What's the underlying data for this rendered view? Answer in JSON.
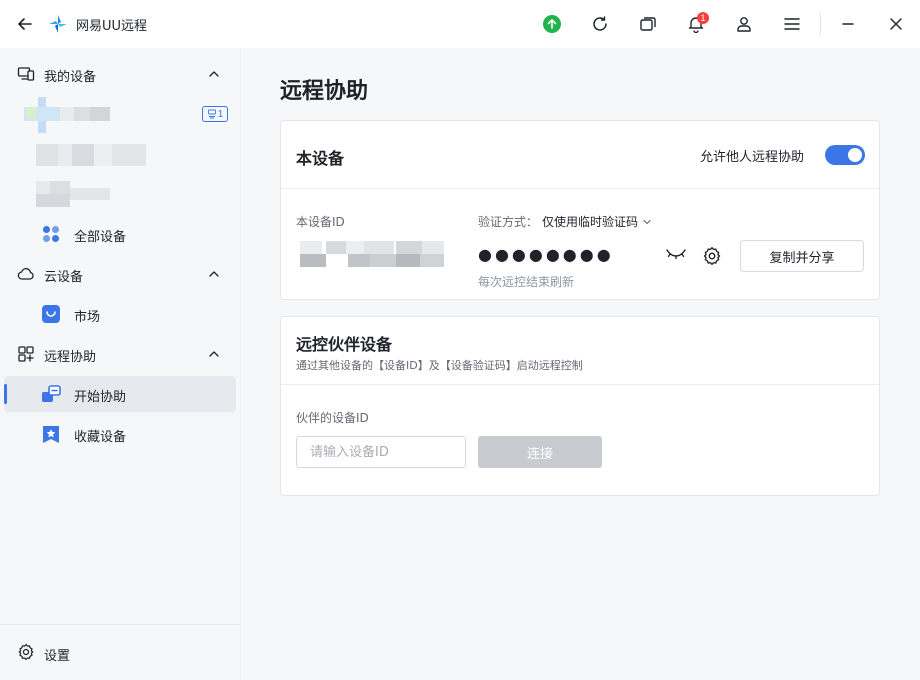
{
  "app": {
    "title": "网易UU远程"
  },
  "titlebar": {
    "notifications_count": "1",
    "icons": [
      "back-arrow-icon",
      "upgrade-icon",
      "refresh-icon",
      "windows-icon",
      "bell-icon",
      "user-icon",
      "menu-icon",
      "minimize-icon",
      "close-icon"
    ],
    "upgrade_color": "#22b34c",
    "badge_color": "#f5413d"
  },
  "sidebar": {
    "my_devices": {
      "label": "我的设备",
      "device_count": "1",
      "all_devices_label": "全部设备"
    },
    "cloud_devices": {
      "label": "云设备",
      "market_label": "市场"
    },
    "remote_assist": {
      "label": "远程协助",
      "start_label": "开始协助",
      "favorites_label": "收藏设备"
    },
    "settings_label": "设置"
  },
  "main": {
    "title": "远程协助",
    "this_device": {
      "title": "本设备",
      "allow_label": "允许他人远程协助",
      "allow_enabled": true,
      "id_label": "本设备ID",
      "verify_label": "验证方式：",
      "verify_value": "仅使用临时验证码",
      "password_masked": "●●●●●●●●",
      "refresh_note": "每次远控结束刷新",
      "share_button": "复制并分享"
    },
    "partner": {
      "title": "远控伙伴设备",
      "subtitle": "通过其他设备的【设备ID】及【设备验证码】启动远程控制",
      "id_label": "伙伴的设备ID",
      "input_placeholder": "请输入设备ID",
      "connect_button": "连接"
    }
  },
  "colors": {
    "accent": "#3b75e8",
    "sidebar_bg": "#f5f7f9"
  }
}
